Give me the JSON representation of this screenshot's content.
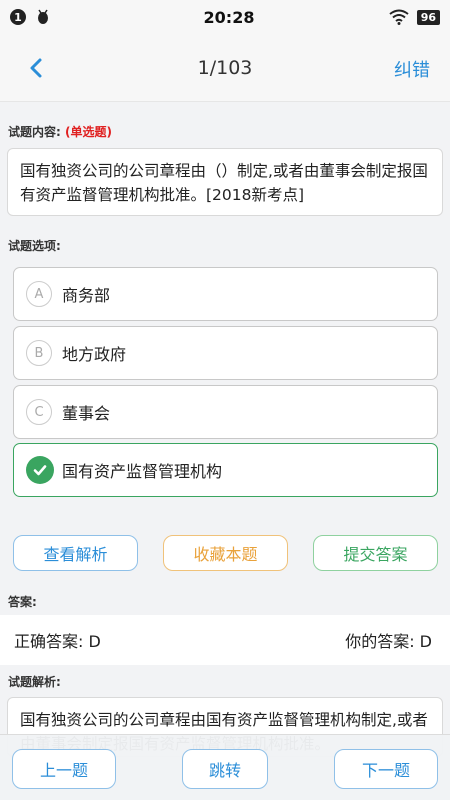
{
  "status": {
    "notification_count": "1",
    "time": "20:28",
    "battery": "96"
  },
  "nav": {
    "progress": "1/103",
    "report_label": "纠错"
  },
  "question": {
    "content_label": "试题内容:",
    "type": "(单选题)",
    "text": "国有独资公司的公司章程由（）制定,或者由董事会制定报国有资产监督管理机构批准。[2018新考点]",
    "options_label": "试题选项:",
    "options": [
      {
        "letter": "A",
        "text": "商务部"
      },
      {
        "letter": "B",
        "text": "地方政府"
      },
      {
        "letter": "C",
        "text": "董事会"
      },
      {
        "letter": "D",
        "text": "国有资产监督管理机构",
        "selected": true
      }
    ]
  },
  "actions": {
    "analysis": "查看解析",
    "favorite": "收藏本题",
    "submit": "提交答案"
  },
  "answer": {
    "label": "答案:",
    "correct": "正确答案: D",
    "yours": "你的答案: D"
  },
  "explanation": {
    "label": "试题解析:",
    "text": "国有独资公司的公司章程由国有资产监督管理机构制定,或者由董事会制定报国有资产监督管理机构批准。"
  },
  "bottom": {
    "prev": "上一题",
    "jump": "跳转",
    "next": "下一题"
  },
  "colors": {
    "accent": "#2b8ed8",
    "correct": "#3aa560",
    "favorite": "#e9a23b",
    "tag": "#e02020"
  }
}
